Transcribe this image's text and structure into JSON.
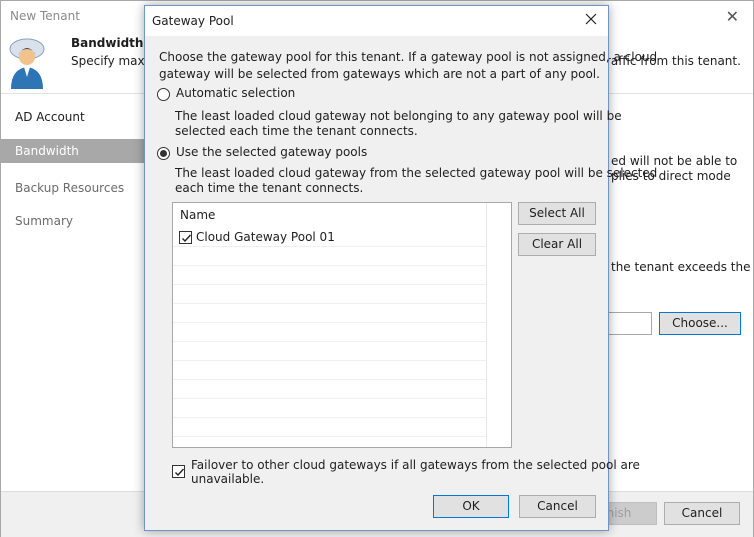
{
  "wizard": {
    "title": "New Tenant",
    "header_title": "Bandwidth",
    "header_desc": "Specify maxim",
    "header_desc_right": "raffic from this tenant.",
    "nav": [
      {
        "label": "AD Account"
      },
      {
        "label": "Bandwidth"
      },
      {
        "label": "Backup Resources"
      },
      {
        "label": "Summary"
      }
    ],
    "right_text": [
      "ed will not be able to",
      "plies to direct mode",
      "the tenant exceeds the"
    ],
    "choose_label": "Choose...",
    "finish_label": "nish",
    "cancel_label": "Cancel"
  },
  "dialog": {
    "title": "Gateway Pool",
    "intro_line1": "Choose the gateway pool for this tenant. If a gateway pool is not assigned, a cloud",
    "intro_line2": "gateway will be selected from gateways which are not a part of any pool.",
    "option_auto": {
      "label": "Automatic selection",
      "desc_line1": "The least loaded cloud gateway not belonging to any gateway pool will be",
      "desc_line2": "selected each time the tenant connects.",
      "selected": false
    },
    "option_selected": {
      "label": "Use the selected gateway pools",
      "desc_line1": "The least loaded cloud gateway from the selected gateway pool will be selected",
      "desc_line2": "each time the tenant connects.",
      "selected": true
    },
    "list": {
      "column_name": "Name",
      "items": [
        {
          "name": "Cloud Gateway Pool 01",
          "checked": true
        }
      ]
    },
    "select_all_label": "Select All",
    "clear_all_label": "Clear All",
    "failover_line1": "Failover to other cloud gateways if all gateways from the selected pool are",
    "failover_line2": "unavailable.",
    "failover_checked": true,
    "ok_label": "OK",
    "cancel_label": "Cancel"
  },
  "colors": {
    "accent_border": "#0078d7",
    "nav_active": "#a8a8a8",
    "dialog_bg": "#f0f0f0"
  }
}
